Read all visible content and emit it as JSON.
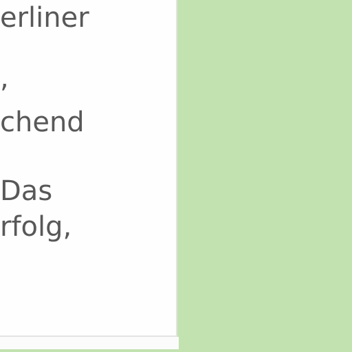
{
  "article": {
    "lines": [
      "erliner",
      ",",
      "chend",
      "Das",
      "rfolg,"
    ]
  }
}
